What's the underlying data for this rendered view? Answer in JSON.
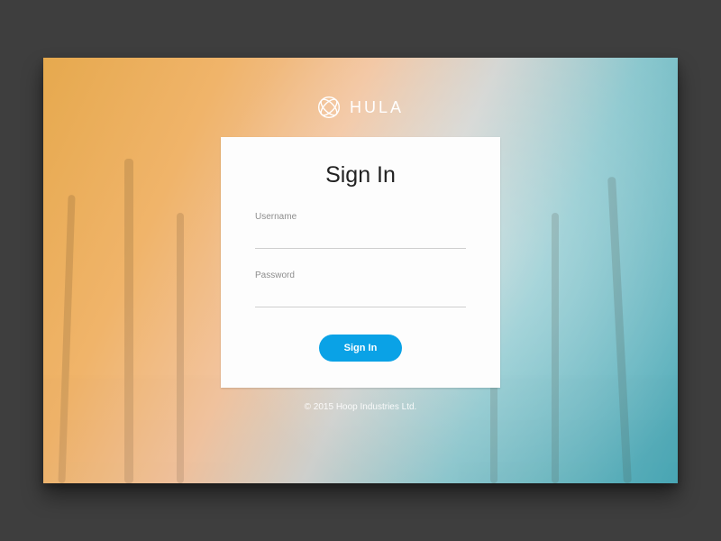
{
  "brand": {
    "name": "HULA"
  },
  "card": {
    "title": "Sign In",
    "username": {
      "label": "Username",
      "value": ""
    },
    "password": {
      "label": "Password",
      "value": ""
    },
    "submit_label": "Sign In"
  },
  "footer": {
    "copyright": "© 2015 Hoop Industries Ltd."
  }
}
